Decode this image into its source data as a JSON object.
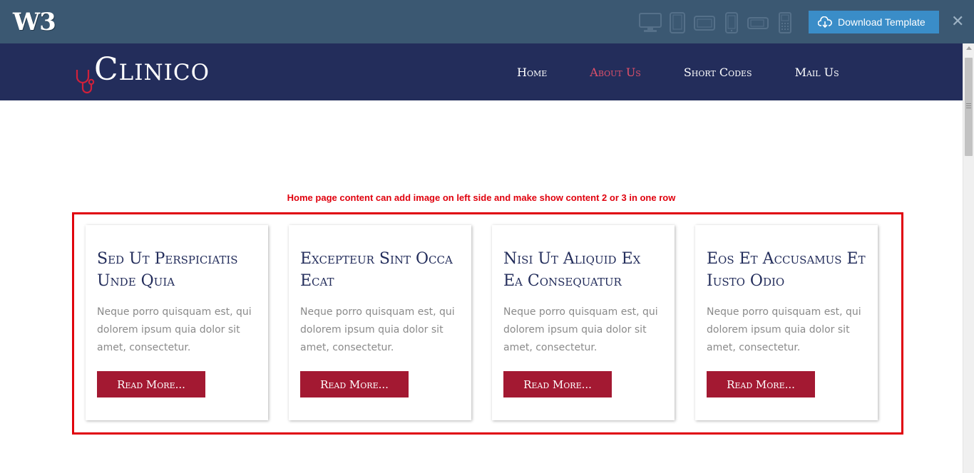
{
  "topbar": {
    "logo_text": "W3",
    "devices": [
      {
        "icon": "desktop-icon"
      },
      {
        "icon": "tablet-portrait-icon"
      },
      {
        "icon": "tablet-landscape-icon"
      },
      {
        "icon": "phone-portrait-icon"
      },
      {
        "icon": "phone-landscape-icon"
      },
      {
        "icon": "feature-phone-icon"
      }
    ],
    "download_label": "Download Template",
    "close_label": "✕"
  },
  "site": {
    "brand": "Clinico",
    "brand_icon": "stethoscope-icon",
    "menu": [
      {
        "label": "Home",
        "active": false
      },
      {
        "label": "About Us",
        "active": true
      },
      {
        "label": "Short Codes",
        "active": false
      },
      {
        "label": "Mail Us",
        "active": false
      }
    ]
  },
  "content": {
    "note": "Home page content can add image on left side and make show content 2 or 3 in one row",
    "cards": [
      {
        "title": "Sed Ut Perspiciatis Unde Quia",
        "text": "Neque porro quisquam est, qui dolorem ipsum quia dolor sit amet, consectetur.",
        "button": "Read More..."
      },
      {
        "title": "Excepteur Sint Occa Ecat",
        "text": "Neque porro quisquam est, qui dolorem ipsum quia dolor sit amet, consectetur.",
        "button": "Read More..."
      },
      {
        "title": "Nisi Ut Aliquid Ex Ea Consequatur",
        "text": "Neque porro quisquam est, qui dolorem ipsum quia dolor sit amet, consectetur.",
        "button": "Read More..."
      },
      {
        "title": "Eos Et Accusamus Et Iusto Odio",
        "text": "Neque porro quisquam est, qui dolorem ipsum quia dolor sit amet, consectetur.",
        "button": "Read More..."
      }
    ]
  },
  "colors": {
    "topbar": "#3b5872",
    "nav": "#232d5b",
    "accent_red": "#a31932",
    "active_link": "#e0506a",
    "note_red": "#e0000d"
  }
}
